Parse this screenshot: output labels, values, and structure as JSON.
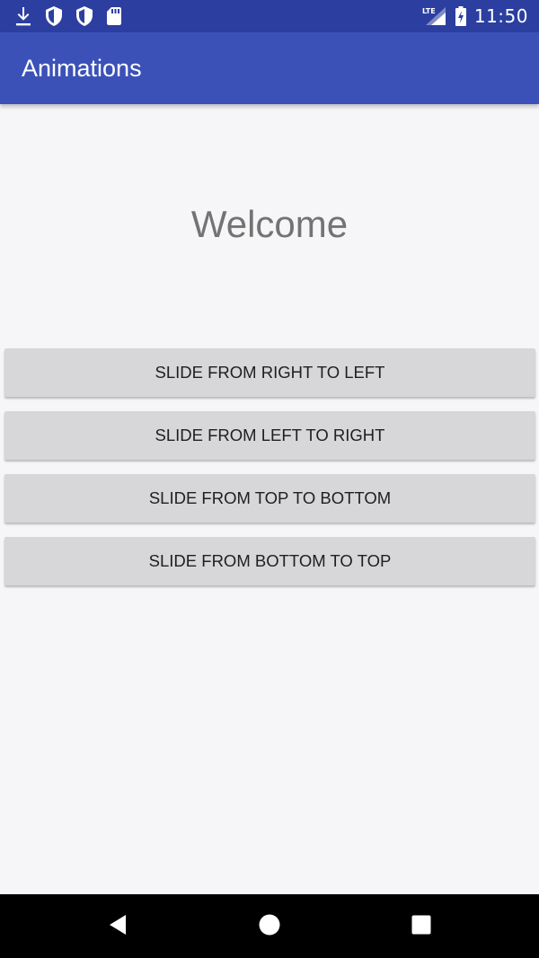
{
  "status_bar": {
    "time": "11:50",
    "network": "LTE",
    "icons": [
      "download-icon",
      "shield-icon",
      "shield-icon",
      "sd-card-icon",
      "signal-icon",
      "battery-charging-icon"
    ]
  },
  "app_bar": {
    "title": "Animations"
  },
  "main": {
    "welcome": "Welcome",
    "buttons": [
      {
        "label": "SLIDE FROM RIGHT TO LEFT"
      },
      {
        "label": "SLIDE FROM LEFT TO RIGHT"
      },
      {
        "label": "SLIDE FROM TOP TO BOTTOM"
      },
      {
        "label": "SLIDE FROM BOTTOM TO TOP"
      }
    ]
  },
  "nav_bar": {
    "icons": [
      "back-icon",
      "home-icon",
      "recents-icon"
    ]
  },
  "colors": {
    "status_bar": "#2c3fa0",
    "app_bar": "#3b51b8",
    "background": "#f6f5f7",
    "button": "#d7d6d8",
    "welcome_text": "#737373"
  }
}
